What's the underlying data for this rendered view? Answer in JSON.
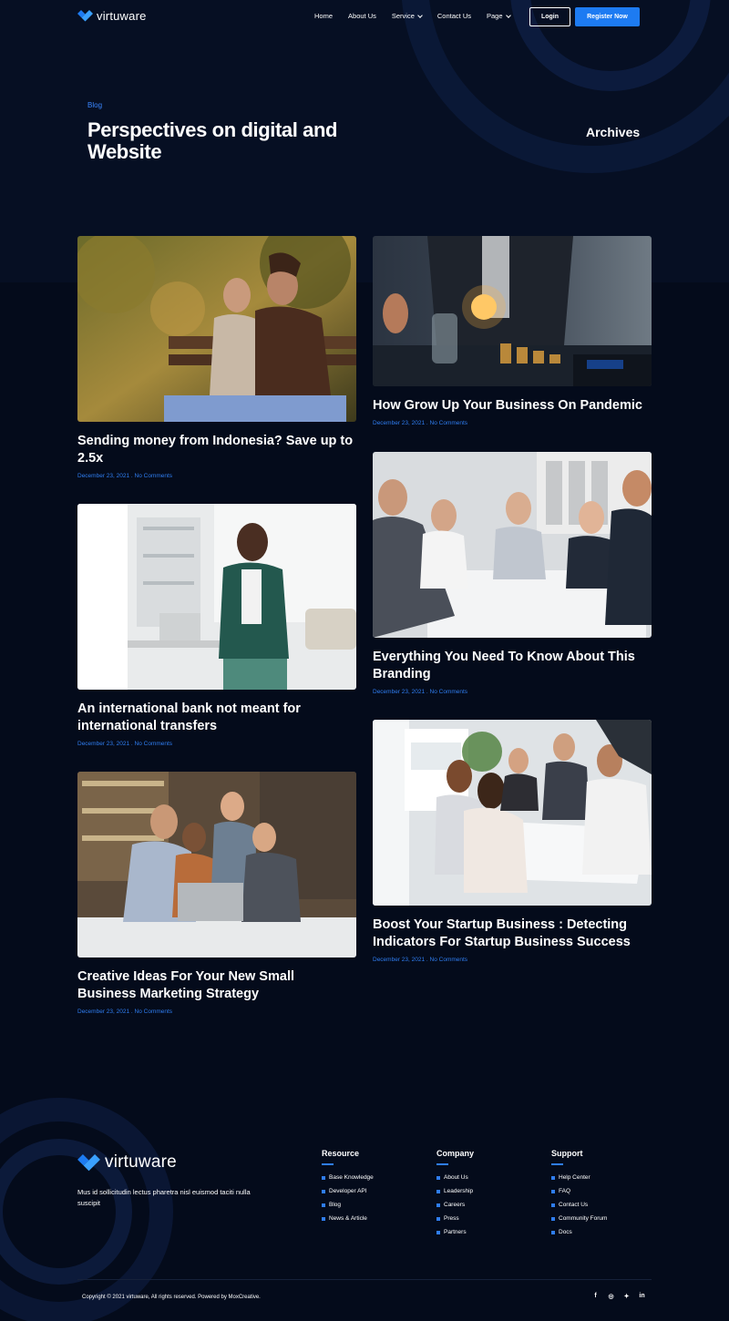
{
  "brand": {
    "name": "virtuware",
    "accent": "#1d7bf2"
  },
  "nav": {
    "links": [
      {
        "label": "Home",
        "dropdown": false
      },
      {
        "label": "About Us",
        "dropdown": false
      },
      {
        "label": "Service",
        "dropdown": true
      },
      {
        "label": "Contact Us",
        "dropdown": false
      },
      {
        "label": "Page",
        "dropdown": true
      }
    ],
    "login": "Login",
    "register": "Register Now"
  },
  "hero": {
    "eyebrow": "Blog",
    "title": "Perspectives on digital and Website",
    "aside": "Archives"
  },
  "posts": [
    {
      "title": "Sending money from Indonesia? Save up to 2.5x",
      "date": "December 23, 2021",
      "comments": "No Comments",
      "image": "couple-on-bench-photo"
    },
    {
      "title": "How Grow Up Your Business On Pandemic",
      "date": "December 23, 2021",
      "comments": "No Comments",
      "image": "lightbulb-coins-photo"
    },
    {
      "title": "An international bank not meant for international transfers",
      "date": "December 23, 2021",
      "comments": "No Comments",
      "image": "man-with-phone-photo"
    },
    {
      "title": "Everything You Need To Know About This Branding",
      "date": "December 23, 2021",
      "comments": "No Comments",
      "image": "team-meeting-photo"
    },
    {
      "title": "Creative Ideas For Your New Small Business Marketing Strategy",
      "date": "December 23, 2021",
      "comments": "No Comments",
      "image": "team-laptop-photo"
    },
    {
      "title": "Boost Your Startup Business : Detecting Indicators For Startup Business Success",
      "date": "December 23, 2021",
      "comments": "No Comments",
      "image": "office-meeting-photo"
    }
  ],
  "meta_separator": " . ",
  "footer": {
    "tagline": "Mus id sollicitudin lectus pharetra nisl euismod taciti nulla suscipit",
    "columns": [
      {
        "heading": "Resource",
        "items": [
          "Base Knowledge",
          "Developer API",
          "Blog",
          "News & Article"
        ]
      },
      {
        "heading": "Company",
        "items": [
          "About Us",
          "Leadership",
          "Careers",
          "Press",
          "Partners"
        ]
      },
      {
        "heading": "Support",
        "items": [
          "Help Center",
          "FAQ",
          "Contact Us",
          "Community Forum",
          "Docs"
        ]
      }
    ],
    "copyright": "Copyright © 2021 virtuware, All rights reserved. Powered by MoxCreative.",
    "socials": [
      {
        "icon": "facebook-icon",
        "glyph": "f"
      },
      {
        "icon": "instagram-icon",
        "glyph": "◎"
      },
      {
        "icon": "twitter-icon",
        "glyph": "✦"
      },
      {
        "icon": "linkedin-icon",
        "glyph": "in"
      }
    ]
  }
}
